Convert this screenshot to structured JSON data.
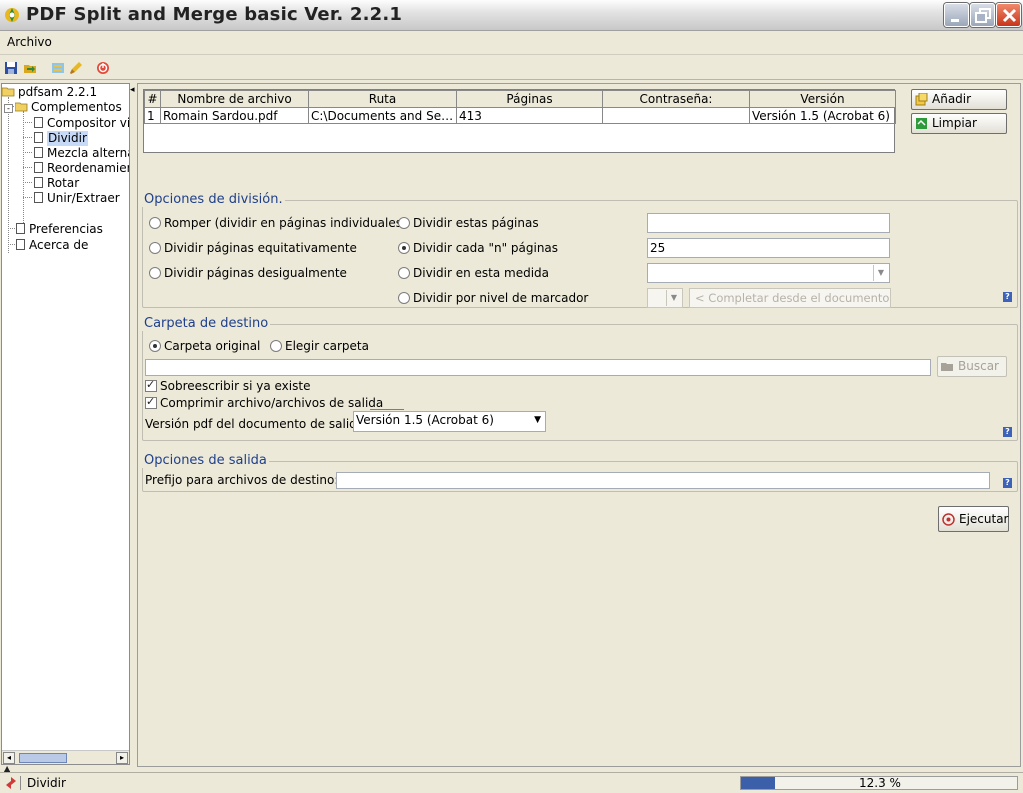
{
  "window": {
    "title": "PDF Split and Merge basic Ver. 2.2.1"
  },
  "menubar": {
    "items": [
      "Archivo"
    ]
  },
  "toolbar": {
    "icons": [
      "save-icon",
      "open-icon",
      "settings-icon",
      "clear-icon",
      "exit-icon"
    ]
  },
  "tree": {
    "root": "pdfsam 2.2.1",
    "plugins_folder": "Complementos",
    "plugins": [
      "Compositor vi",
      "Dividir",
      "Mezcla alterna",
      "Reordenamier",
      "Rotar",
      "Unir/Extraer"
    ],
    "selected": "Dividir",
    "others": [
      "Preferencias",
      "Acerca de"
    ]
  },
  "file_table": {
    "columns": [
      "#",
      "Nombre de archivo",
      "Ruta",
      "Páginas",
      "Contraseña:",
      "Versión"
    ],
    "rows": [
      [
        "1",
        "Romain Sardou.pdf",
        "C:\\Documents and Sett...",
        "413",
        "",
        "Versión 1.5 (Acrobat 6)"
      ]
    ]
  },
  "buttons": {
    "add": "Añadir",
    "clear": "Limpiar",
    "browse": "Buscar",
    "run": "Ejecutar"
  },
  "split_options": {
    "title": "Opciones de división.",
    "burst": "Romper (dividir en páginas individuales)",
    "even": "Dividir páginas equitativamente",
    "odd": "Dividir páginas desigualmente",
    "these_pages": "Dividir estas páginas",
    "every_n": "Dividir cada \"n\" páginas",
    "size": "Dividir en esta medida",
    "bookmark": "Dividir por nivel de marcador",
    "these_pages_value": "",
    "every_n_value": "25",
    "fill_from_doc": "< Completar desde el documento",
    "selected": "every_n"
  },
  "destination": {
    "title": "Carpeta de destino",
    "original": "Carpeta original",
    "choose": "Elegir carpeta",
    "selected": "original",
    "path_value": "",
    "overwrite": "Sobreescribir si ya existe",
    "overwrite_checked": true,
    "compress": "Comprimir archivo/archivos de salida",
    "compress_checked": true,
    "pdf_version_label": "Versión pdf del documento de salida",
    "pdf_version_value": "Versión 1.5 (Acrobat 6)"
  },
  "output": {
    "title": "Opciones de salida",
    "prefix_label": "Prefijo para archivos de destino:",
    "prefix_value": ""
  },
  "help_icon_text": "?",
  "statusbar": {
    "text": "Dividir",
    "progress_fraction": 0.123,
    "progress_text": "12.3 %"
  },
  "colors": {
    "accent": "#3b5fa8",
    "group_title": "#1e3f8c"
  }
}
